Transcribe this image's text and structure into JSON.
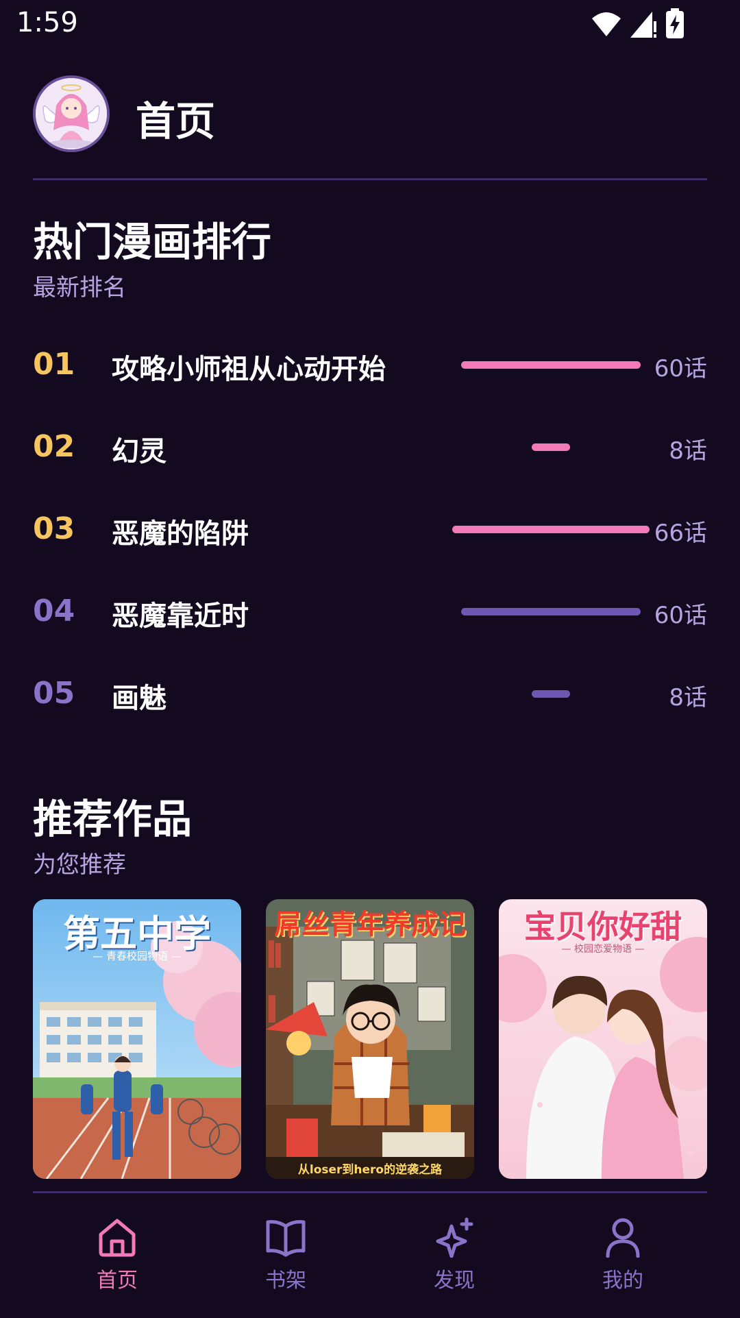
{
  "status_bar": {
    "time": "1:59",
    "icons": [
      "wifi-icon",
      "signal-icon",
      "battery-charging-icon"
    ]
  },
  "header": {
    "title": "首页",
    "avatar_icon": "angel-avatar-icon"
  },
  "ranking": {
    "title": "热门漫画排行",
    "subtitle": "最新排名",
    "items": [
      {
        "rank": "01",
        "title": "攻略小师祖从心动开始",
        "count": "60话",
        "progress": 0.91,
        "rank_color": "#f6c560",
        "bar_color": "#f27ab8"
      },
      {
        "rank": "02",
        "title": "幻灵",
        "count": "8话",
        "progress": 0.12,
        "rank_color": "#f6c560",
        "bar_color": "#f27ab8"
      },
      {
        "rank": "03",
        "title": "恶魔的陷阱",
        "count": "66话",
        "progress": 1.0,
        "rank_color": "#f6c560",
        "bar_color": "#f27ab8"
      },
      {
        "rank": "04",
        "title": "恶魔靠近时",
        "count": "60话",
        "progress": 0.91,
        "rank_color": "#8b73c9",
        "bar_color": "#6e57b3"
      },
      {
        "rank": "05",
        "title": "画魅",
        "count": "8话",
        "progress": 0.12,
        "rank_color": "#8b73c9",
        "bar_color": "#6e57b3"
      }
    ]
  },
  "recommend": {
    "title": "推荐作品",
    "subtitle": "为您推荐",
    "items": [
      {
        "cover_title": "第五中学",
        "cover_subtitle": "— 青春校园物语 —"
      },
      {
        "cover_title": "屌丝青年养成记",
        "cover_subtitle": "从loser到hero的逆袭之路"
      },
      {
        "cover_title": "宝贝你好甜",
        "cover_subtitle": "— 校园恋爱物语 —"
      }
    ]
  },
  "nav": {
    "active_color": "#f27ab8",
    "inactive_color": "#8b73c9",
    "items": [
      {
        "label": "首页",
        "icon": "home-icon",
        "active": true
      },
      {
        "label": "书架",
        "icon": "book-icon",
        "active": false
      },
      {
        "label": "发现",
        "icon": "sparkle-icon",
        "active": false
      },
      {
        "label": "我的",
        "icon": "user-icon",
        "active": false
      }
    ]
  }
}
